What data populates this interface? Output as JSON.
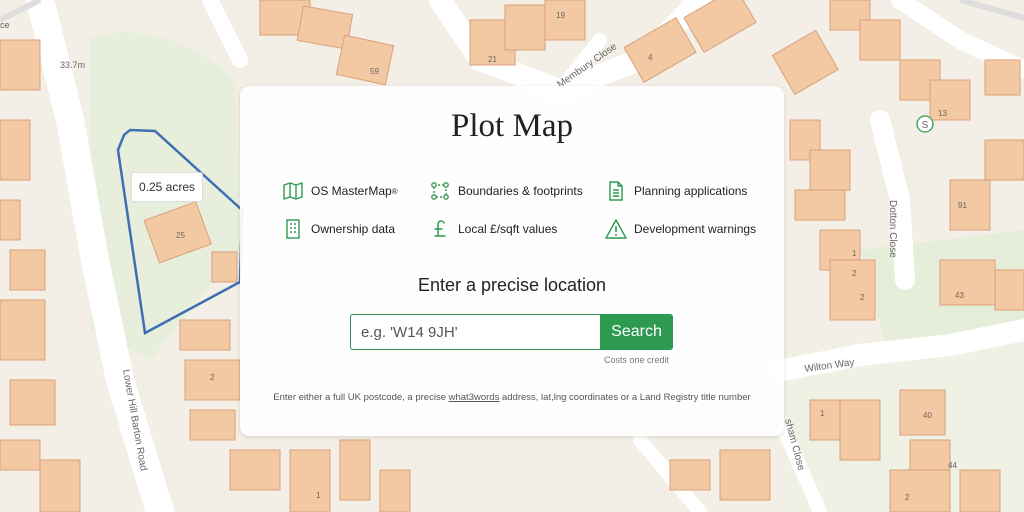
{
  "title": "Plot Map",
  "features": [
    {
      "icon": "map-icon",
      "label": "OS MasterMap",
      "sup": "®"
    },
    {
      "icon": "boundaries-icon",
      "label": "Boundaries & footprints"
    },
    {
      "icon": "document-icon",
      "label": "Planning applications"
    },
    {
      "icon": "building-icon",
      "label": "Ownership data"
    },
    {
      "icon": "pound-icon",
      "label": "Local £/sqft values"
    },
    {
      "icon": "warning-icon",
      "label": "Development warnings"
    }
  ],
  "search": {
    "heading": "Enter a precise location",
    "placeholder": "e.g. 'W14 9JH'",
    "button_label": "Search",
    "cost_note": "Costs one credit",
    "hint_before": "Enter either a full UK postcode, a precise ",
    "hint_link": "what3words",
    "hint_after": " address, lat,lng coordinates or a Land Registry title number"
  },
  "map": {
    "plot_label": "0.25 acres",
    "scale_label": "33.7m",
    "roads": {
      "membury_close": "Membury Close",
      "dotton_close": "Dotton Close",
      "wilton_way": "Wilton Way",
      "lower_hill_barton_road": "Lower Hill Barton Road",
      "sham_close": "sham Close",
      "ce": "ce"
    },
    "numbers": [
      "21",
      "19",
      "4",
      "13",
      "91",
      "1",
      "2",
      "43",
      "1",
      "40",
      "2",
      "44",
      "2",
      "25",
      "59",
      "2",
      "1"
    ],
    "s_marker": "S",
    "colors": {
      "building_fill": "#f3c9a3",
      "building_stroke": "#d9a07a",
      "land": "#f3efe6",
      "road": "#ffffff",
      "green": "#e4ecd9",
      "plot_outline": "#3d6fb3",
      "accent": "#2d9a50"
    }
  }
}
